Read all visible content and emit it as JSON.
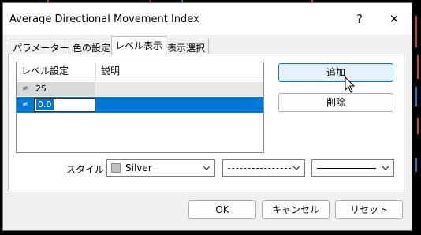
{
  "window": {
    "title": "Average Directional Movement Index",
    "help_glyph": "?",
    "close_glyph": "✕"
  },
  "tabs": [
    {
      "label": "パラメーター",
      "active": false
    },
    {
      "label": "色の設定",
      "active": false
    },
    {
      "label": "レベル表示",
      "active": true
    },
    {
      "label": "表示選択",
      "active": false
    }
  ],
  "level_list": {
    "columns": [
      "レベル設定",
      "説明"
    ],
    "rows": [
      {
        "value": "25",
        "description": "",
        "icon": "level-line-icon"
      },
      {
        "value": "0.0",
        "description": "",
        "icon": "level-line-icon",
        "editing": true
      }
    ]
  },
  "buttons": {
    "add": "追加",
    "delete": "削除",
    "ok": "OK",
    "cancel": "キャンセル",
    "reset": "リセット"
  },
  "style": {
    "label": "スタイル：",
    "color_value": "Silver",
    "color_hex": "#c0c0c0",
    "line_style": "dashed",
    "line_width": "solid-thin"
  },
  "colors": {
    "selection": "#0078d7",
    "hover_button": "#e5f1fb",
    "chart_red": "#e0442a",
    "chart_blue": "#2b7de0"
  }
}
